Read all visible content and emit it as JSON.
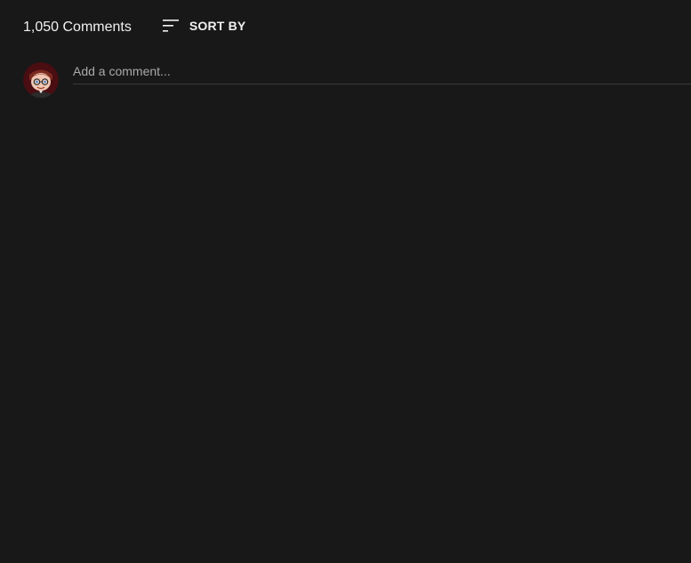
{
  "comments": {
    "count_label": "1,050 Comments",
    "sort_label": "SORT BY",
    "sort_icon": "sort-icon"
  },
  "composer": {
    "placeholder": "Add a comment...",
    "value": "",
    "avatar_icon": "user-avatar"
  },
  "colors": {
    "background": "#181818",
    "text": "#f1f1f1",
    "placeholder": "#aaaaaa",
    "divider": "#3a3a3a"
  }
}
